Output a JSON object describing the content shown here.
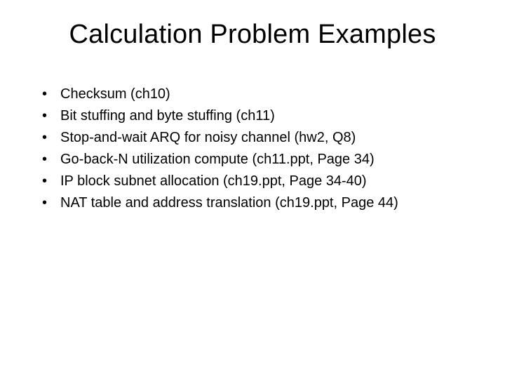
{
  "slide": {
    "title": "Calculation Problem Examples",
    "bullets": [
      "Checksum (ch10)",
      "Bit stuffing and byte stuffing (ch11)",
      "Stop-and-wait ARQ for noisy channel (hw2, Q8)",
      "Go-back-N utilization compute (ch11.ppt, Page 34)",
      "IP block subnet allocation (ch19.ppt, Page 34-40)",
      "NAT table and address translation (ch19.ppt, Page 44)"
    ]
  }
}
